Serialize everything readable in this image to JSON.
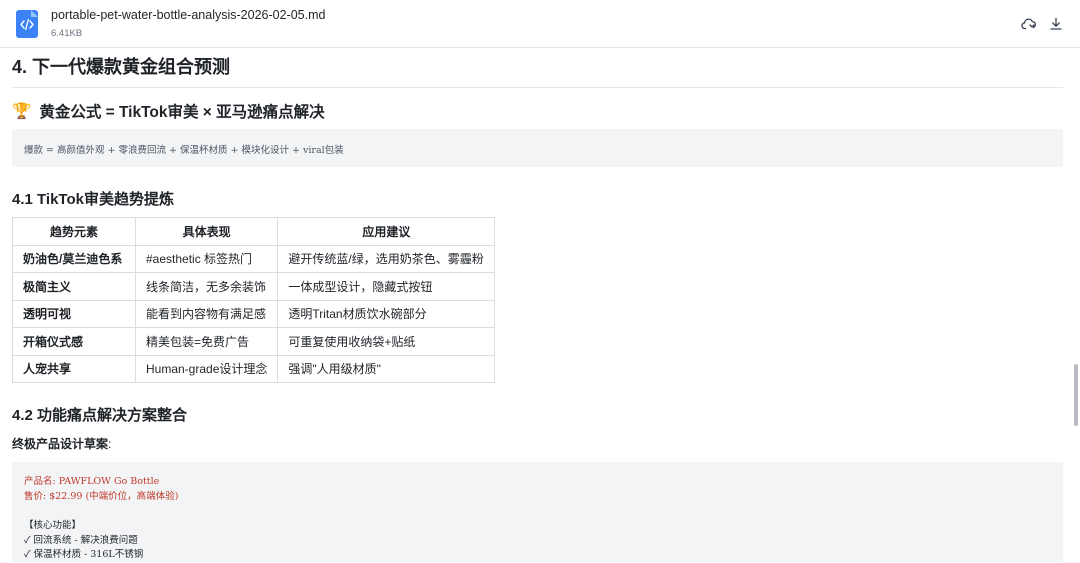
{
  "header": {
    "file_name": "portable-pet-water-bottle-analysis-2026-02-05.md",
    "file_size": "6.41KB",
    "icons": [
      "code-file-icon",
      "cloud-sync-icon",
      "download-icon"
    ]
  },
  "doc": {
    "h2": "4. 下一代爆款黄金组合预测",
    "formula_emoji": "🏆",
    "formula_heading": "黄金公式 = TikTok审美 × 亚马逊痛点解决",
    "formula_code": "爆款 = 高颜值外观 + 零浪费回流 + 保温杯材质 + 模块化设计 +  viral包装",
    "s41": "4.1 TikTok审美趋势提炼",
    "table": {
      "headers": [
        "趋势元素",
        "具体表现",
        "应用建议"
      ],
      "rows": [
        [
          "奶油色/莫兰迪色系",
          "#aesthetic 标签热门",
          "避开传统蓝/绿，选用奶茶色、雾霾粉"
        ],
        [
          "极简主义",
          "线条简洁，无多余装饰",
          "一体成型设计，隐藏式按钮"
        ],
        [
          "透明可视",
          "能看到内容物有满足感",
          "透明Tritan材质饮水碗部分"
        ],
        [
          "开箱仪式感",
          "精美包装=免费广告",
          "可重复使用收纳袋+贴纸"
        ],
        [
          "人宠共享",
          "Human-grade设计理念",
          "强调\"人用级材质\""
        ]
      ]
    },
    "s42": "4.2 功能痛点解决方案整合",
    "draft_label": "终极产品设计草案",
    "draft_colon": ":",
    "draft_code": {
      "line1": "产品名: PAWFLOW Go Bottle",
      "line2": "售价: $22.99 (中端价位，高端体验)",
      "line3": "【核心功能】",
      "line4": "✓ 回流系统 - 解决浪费问题",
      "line5": "✓ 保温杯材质 - 316L不锈钢"
    }
  },
  "colors": {
    "accent": "#3b82f6",
    "code_bg": "#f3f4f6",
    "code_red": "#c0392b"
  }
}
